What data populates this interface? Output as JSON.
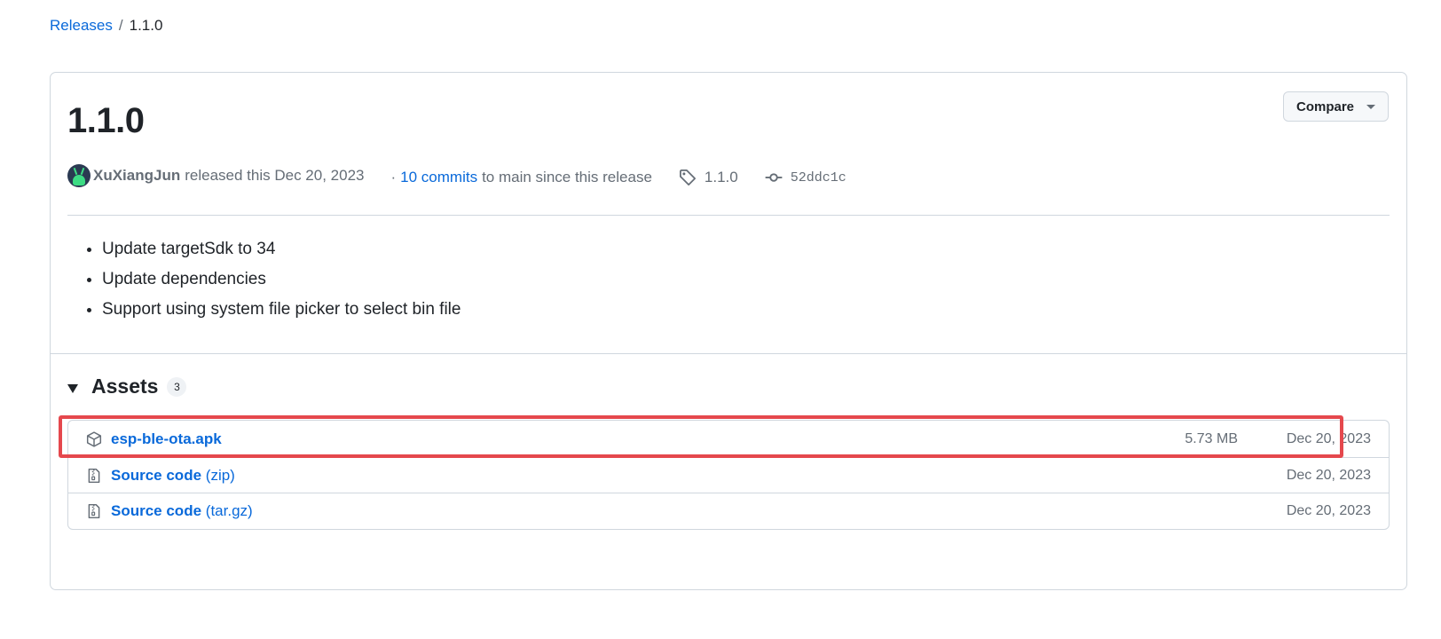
{
  "breadcrumb": {
    "parent": "Releases",
    "separator": "/",
    "current": "1.1.0"
  },
  "release": {
    "title": "1.1.0",
    "compare_label": "Compare",
    "author": "XuXiangJun",
    "released_text": "released this Dec 20, 2023",
    "dot": "·",
    "commits_link": "10 commits",
    "commits_rest": "to main since this release",
    "tag": "1.1.0",
    "commit_hash": "52ddc1c",
    "notes": [
      "Update targetSdk to 34",
      "Update dependencies",
      "Support using system file picker to select bin file"
    ]
  },
  "assets": {
    "title": "Assets",
    "count": "3",
    "items": [
      {
        "name": "esp-ble-ota.apk",
        "ext": "",
        "size": "5.73 MB",
        "date": "Dec 20, 2023",
        "icon": "package-icon"
      },
      {
        "name": "Source code",
        "ext": "(zip)",
        "size": "",
        "date": "Dec 20, 2023",
        "icon": "file-zip-icon"
      },
      {
        "name": "Source code",
        "ext": "(tar.gz)",
        "size": "",
        "date": "Dec 20, 2023",
        "icon": "file-zip-icon"
      }
    ]
  },
  "colors": {
    "link": "#0969da",
    "muted": "#656d76",
    "border": "#d0d7de",
    "highlight": "#e5484d"
  }
}
